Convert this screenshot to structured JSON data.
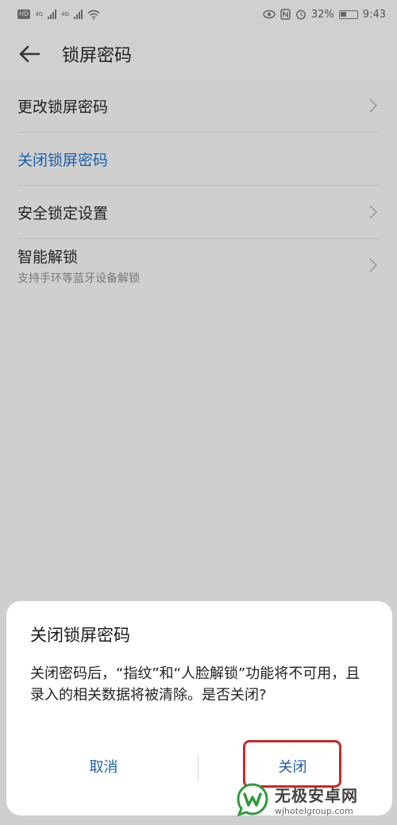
{
  "status_bar": {
    "hd_badge": "HD",
    "net1": "4G",
    "net2": "4G",
    "battery": "32%",
    "time": "9:43",
    "icons": [
      "eye-icon",
      "nfc-icon",
      "alarm-icon",
      "battery-icon"
    ]
  },
  "header": {
    "title": "锁屏密码"
  },
  "menu": {
    "items": [
      {
        "label": "更改锁屏密码"
      },
      {
        "label": "关闭锁屏密码"
      },
      {
        "label": "安全锁定设置"
      },
      {
        "label": "智能解锁",
        "sub": "支持手环等蓝牙设备解锁"
      }
    ]
  },
  "dialog": {
    "title": "关闭锁屏密码",
    "message": "关闭密码后，“指纹”和“人脸解锁”功能将不可用，且录入的相关数据将被清除。是否关闭?",
    "cancel_label": "取消",
    "confirm_label": "关闭"
  },
  "watermark": {
    "name": "无极安卓网",
    "url": "wjhotelgroup.com"
  },
  "colors": {
    "accent": "#1d5fa8",
    "highlight": "#c8282b",
    "overlay_bg": "#cfcfcf",
    "watermark_green": "#2e9b3a"
  }
}
